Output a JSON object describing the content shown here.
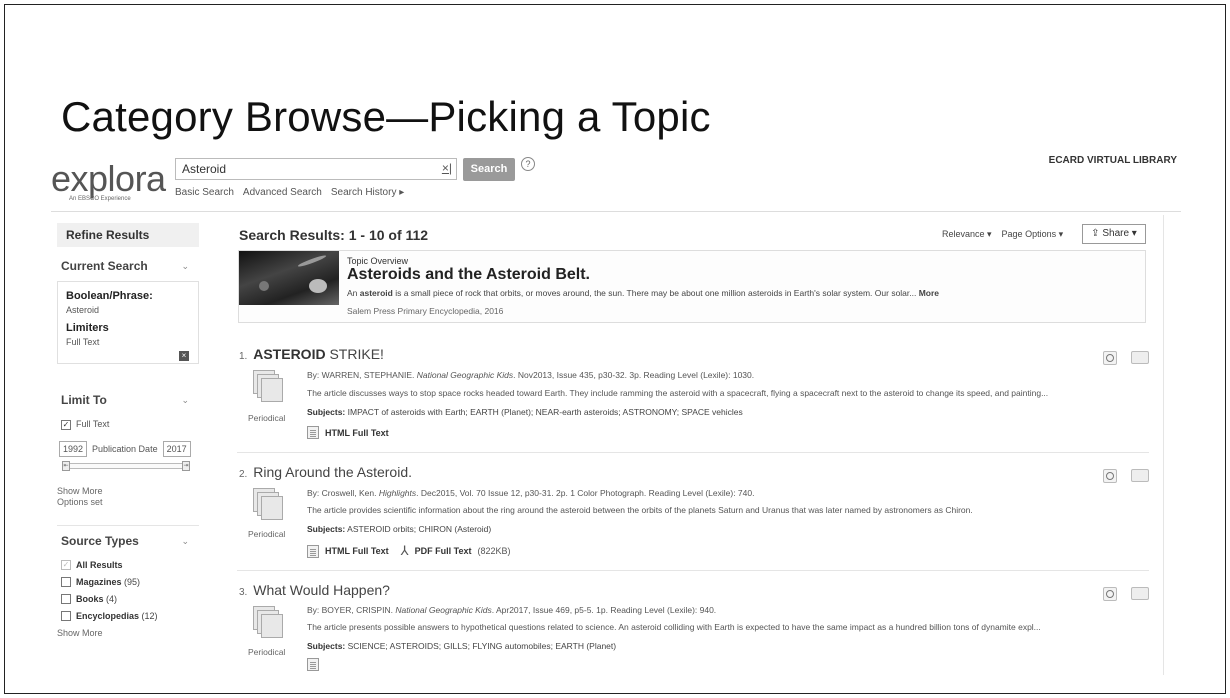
{
  "slide": {
    "title": "Category Browse—Picking a Topic"
  },
  "header": {
    "logo_text": "explora",
    "logo_sub": "An EBSCO Experience",
    "search_value": "Asteroid",
    "clear_label": "×|",
    "search_button": "Search",
    "help_label": "?",
    "nav": [
      "Basic Search",
      "Advanced Search",
      "Search History ▸"
    ],
    "library_name": "ECARD VIRTUAL LIBRARY"
  },
  "sidebar": {
    "refine_title": "Refine Results",
    "current_search": {
      "title": "Current Search",
      "boolean_label": "Boolean/Phrase:",
      "boolean_value": "Asteroid",
      "limiters_label": "Limiters",
      "limiter_value": "Full Text",
      "remove_label": "×"
    },
    "limit_to": {
      "title": "Limit To",
      "full_text_label": "Full Text",
      "date_from": "1992",
      "date_label": "Publication Date",
      "date_to": "2017",
      "show_more": "Show More",
      "options_set": "Options set"
    },
    "source_types": {
      "title": "Source Types",
      "items": [
        {
          "label": "All Results",
          "count": ""
        },
        {
          "label": "Magazines",
          "count": "(95)"
        },
        {
          "label": "Books",
          "count": "(4)"
        },
        {
          "label": "Encyclopedias",
          "count": "(12)"
        }
      ],
      "show_more": "Show More"
    }
  },
  "results": {
    "heading": "Search Results: 1 - 10 of 112",
    "relevance": "Relevance ▾",
    "page_options": "Page Options ▾",
    "share": "Share ▾",
    "topic": {
      "label": "Topic Overview",
      "title": "Asteroids and the Asteroid Belt.",
      "desc_before": "An ",
      "desc_bold": "asteroid",
      "desc_after": " is a small piece of rock that orbits, or moves around, the sun. There may be about one million asteroids in Earth's solar system. Our solar... ",
      "more": "More",
      "source": "Salem Press Primary Encyclopedia, 2016"
    },
    "items": [
      {
        "num": "1.",
        "title_bold": "ASTEROID",
        "title_rest": " STRIKE!",
        "byline_prefix": "By: WARREN, STEPHANIE. ",
        "journal": "National Geographic Kids",
        "byline_rest": ". Nov2013, Issue 435, p30-32. 3p. Reading Level (Lexile): 1030.",
        "abstract": "The article discusses ways to stop space rocks headed toward Earth. They include ramming the asteroid with a spacecraft, flying a spacecraft next to the asteroid to change its speed, and painting...",
        "subjects_label": "Subjects:",
        "subjects": " IMPACT of asteroids with Earth; EARTH (Planet); NEAR-earth asteroids; ASTRONOMY; SPACE vehicles",
        "type": "Periodical",
        "html_link": "HTML Full Text",
        "pdf_link": "",
        "pdf_size": ""
      },
      {
        "num": "2.",
        "title_bold": "",
        "title_rest": "Ring Around the Asteroid.",
        "byline_prefix": "By: Croswell, Ken. ",
        "journal": "Highlights",
        "byline_rest": ". Dec2015, Vol. 70 Issue 12, p30-31. 2p. 1 Color Photograph. Reading Level (Lexile): 740.",
        "abstract": "The article provides scientific information about the ring around the asteroid between the orbits of the planets Saturn and Uranus that was later named by astronomers as Chiron.",
        "subjects_label": "Subjects:",
        "subjects": " ASTEROID orbits; CHIRON (Asteroid)",
        "type": "Periodical",
        "html_link": "HTML Full Text",
        "pdf_link": "PDF Full Text",
        "pdf_size": "(822KB)"
      },
      {
        "num": "3.",
        "title_bold": "",
        "title_rest": "What Would Happen?",
        "byline_prefix": "By: BOYER, CRISPIN. ",
        "journal": "National Geographic Kids",
        "byline_rest": ". Apr2017, Issue 469, p5-5. 1p. Reading Level (Lexile): 940.",
        "abstract": "The article presents possible answers to hypothetical questions related to science. An asteroid colliding with Earth is expected to have the same impact as a hundred billion tons of dynamite expl...",
        "subjects_label": "Subjects:",
        "subjects": " SCIENCE; ASTEROIDS; GILLS; FLYING automobiles; EARTH (Planet)",
        "type": "Periodical",
        "html_link": "",
        "pdf_link": "",
        "pdf_size": ""
      }
    ]
  }
}
